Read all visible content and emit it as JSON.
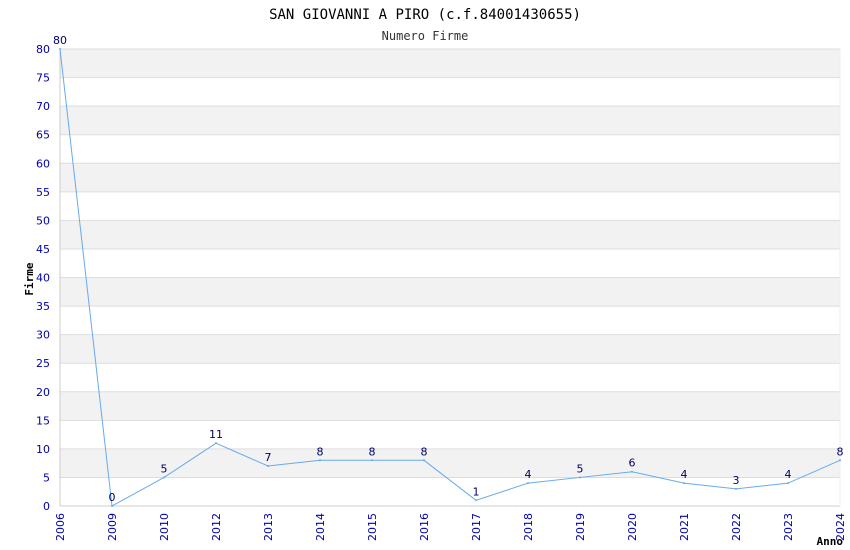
{
  "chart_data": {
    "type": "line",
    "title": "SAN GIOVANNI A PIRO (c.f.84001430655)",
    "subtitle": "Numero Firme",
    "xlabel": "Anno",
    "ylabel": "Firme",
    "categories": [
      "2006",
      "2009",
      "2010",
      "2012",
      "2013",
      "2014",
      "2015",
      "2016",
      "2017",
      "2018",
      "2019",
      "2020",
      "2021",
      "2022",
      "2023",
      "2024"
    ],
    "series": [
      {
        "values": [
          80,
          0,
          5,
          11,
          7,
          8,
          8,
          8,
          1,
          4,
          5,
          6,
          4,
          3,
          4,
          8
        ]
      }
    ],
    "ylim": [
      0,
      80
    ],
    "yticks": [
      0,
      5,
      10,
      15,
      20,
      25,
      30,
      35,
      40,
      45,
      50,
      55,
      60,
      65,
      70,
      75,
      80
    ],
    "grid": true,
    "colors": {
      "line": "#66aaee",
      "band": "#f2f2f2",
      "grid": "#dddddd",
      "tick_text": "#0000aa"
    }
  }
}
